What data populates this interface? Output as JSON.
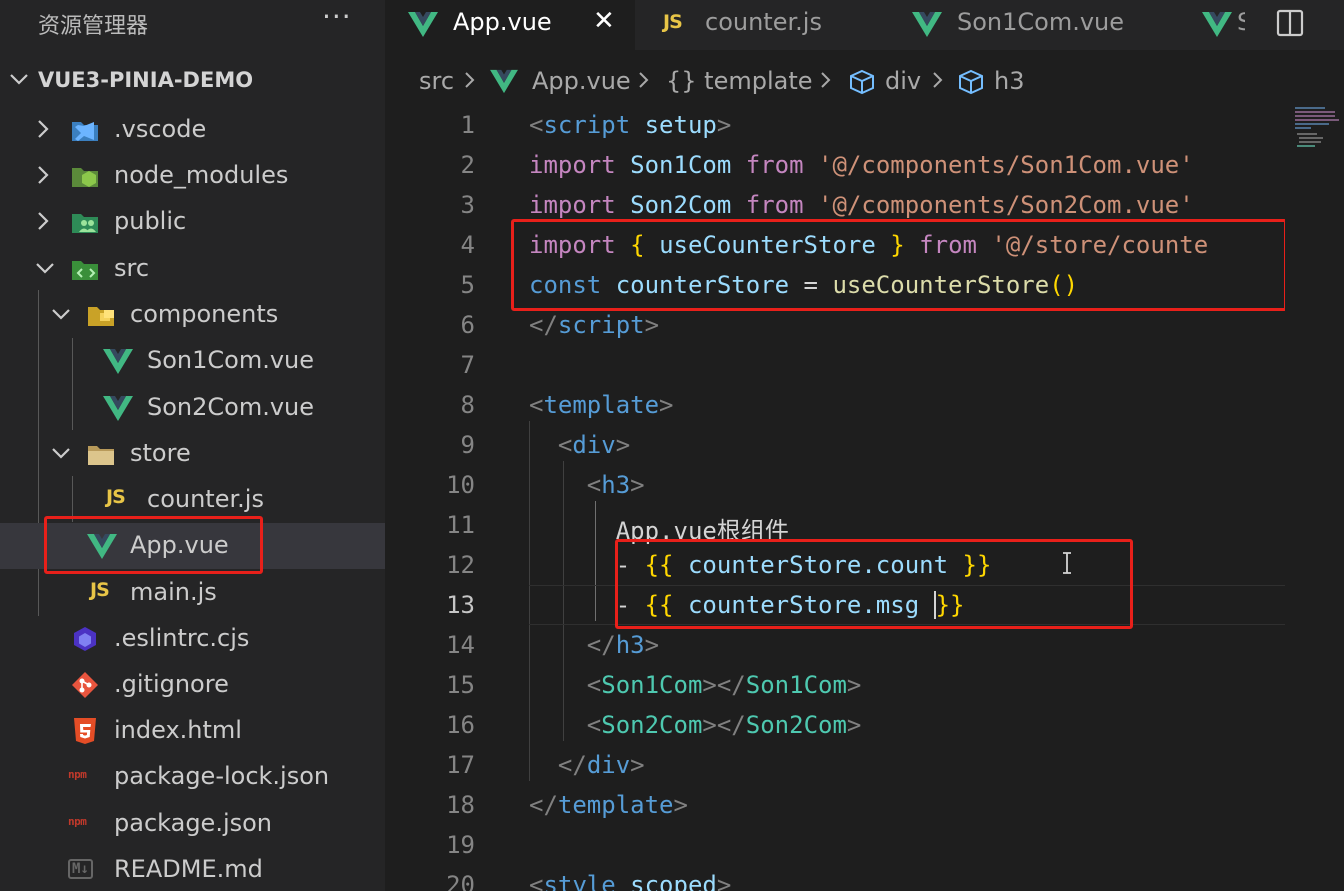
{
  "sidebar": {
    "title": "资源管理器",
    "more_label": "···",
    "project": "VUE3-PINIA-DEMO",
    "items": [
      {
        "label": ".vscode",
        "icon": "vscode-folder-icon"
      },
      {
        "label": "node_modules",
        "icon": "node-folder-icon"
      },
      {
        "label": "public",
        "icon": "public-folder-icon"
      },
      {
        "label": "src",
        "icon": "src-folder-icon"
      },
      {
        "label": "components",
        "icon": "components-folder-icon"
      },
      {
        "label": "Son1Com.vue",
        "icon": "vue-file-icon"
      },
      {
        "label": "Son2Com.vue",
        "icon": "vue-file-icon"
      },
      {
        "label": "store",
        "icon": "folder-icon"
      },
      {
        "label": "counter.js",
        "icon": "js-file-icon"
      },
      {
        "label": "App.vue",
        "icon": "vue-file-icon"
      },
      {
        "label": "main.js",
        "icon": "js-file-icon"
      },
      {
        "label": ".eslintrc.cjs",
        "icon": "eslint-file-icon"
      },
      {
        "label": ".gitignore",
        "icon": "git-file-icon"
      },
      {
        "label": "index.html",
        "icon": "html5-file-icon"
      },
      {
        "label": "package-lock.json",
        "icon": "npm-file-icon"
      },
      {
        "label": "package.json",
        "icon": "npm-file-icon"
      },
      {
        "label": "README.md",
        "icon": "markdown-file-icon"
      }
    ],
    "badges": {
      "js": "JS",
      "npm": "npm",
      "md": "M↓"
    }
  },
  "tabs": [
    {
      "label": "App.vue",
      "active": true
    },
    {
      "label": "counter.js",
      "active": false
    },
    {
      "label": "Son1Com.vue",
      "active": false
    },
    {
      "label": "S",
      "active": false
    }
  ],
  "tab_close": "✕",
  "breadcrumb": [
    "src",
    "App.vue",
    "{} template",
    "div",
    "h3"
  ],
  "code": {
    "line_numbers": [
      "1",
      "2",
      "3",
      "4",
      "5",
      "6",
      "7",
      "8",
      "9",
      "10",
      "11",
      "12",
      "13",
      "14",
      "15",
      "16",
      "17",
      "18",
      "19",
      "20"
    ],
    "current_line": 13,
    "l1": {
      "open": "<",
      "tag": "script",
      "attr": "setup",
      "close": ">"
    },
    "l2": {
      "import": "import",
      "name": "Son1Com",
      "from": "from",
      "path": "'@/components/Son1Com.vue'"
    },
    "l3": {
      "import": "import",
      "name": "Son2Com",
      "from": "from",
      "path": "'@/components/Son2Com.vue'"
    },
    "l4": {
      "import": "import",
      "lb": "{",
      "name": "useCounterStore",
      "rb": "}",
      "from": "from",
      "path": "'@/store/counte"
    },
    "l5": {
      "const": "const",
      "name": "counterStore",
      "eq": "=",
      "fn": "useCounterStore",
      "parens": "()"
    },
    "l6": {
      "open": "</",
      "tag": "script",
      "close": ">"
    },
    "l8": {
      "open": "<",
      "tag": "template",
      "close": ">"
    },
    "l9": {
      "open": "<",
      "tag": "div",
      "close": ">"
    },
    "l10": {
      "open": "<",
      "tag": "h3",
      "close": ">"
    },
    "l11": {
      "text": "App.vue根组件"
    },
    "l12": {
      "dash": "-",
      "lb": "{{",
      "expr": "counterStore.count",
      "rb": "}}"
    },
    "l13": {
      "dash": "-",
      "lb": "{{",
      "expr": "counterStore.msg",
      "rb": "}}"
    },
    "l14": {
      "open": "</",
      "tag": "h3",
      "close": ">"
    },
    "l15": {
      "open": "<",
      "tag": "Son1Com",
      "mid": "></",
      "tag2": "Son1Com",
      "close": ">"
    },
    "l16": {
      "open": "<",
      "tag": "Son2Com",
      "mid": "></",
      "tag2": "Son2Com",
      "close": ">"
    },
    "l17": {
      "open": "</",
      "tag": "div",
      "close": ">"
    },
    "l18": {
      "open": "</",
      "tag": "template",
      "close": ">"
    },
    "l20": {
      "open": "<",
      "tag": "style",
      "attr": "scoped",
      "close": ">"
    }
  },
  "colors": {
    "highlight_box": "#e8201a",
    "vue": "#41b883",
    "js": "#e8c547"
  }
}
